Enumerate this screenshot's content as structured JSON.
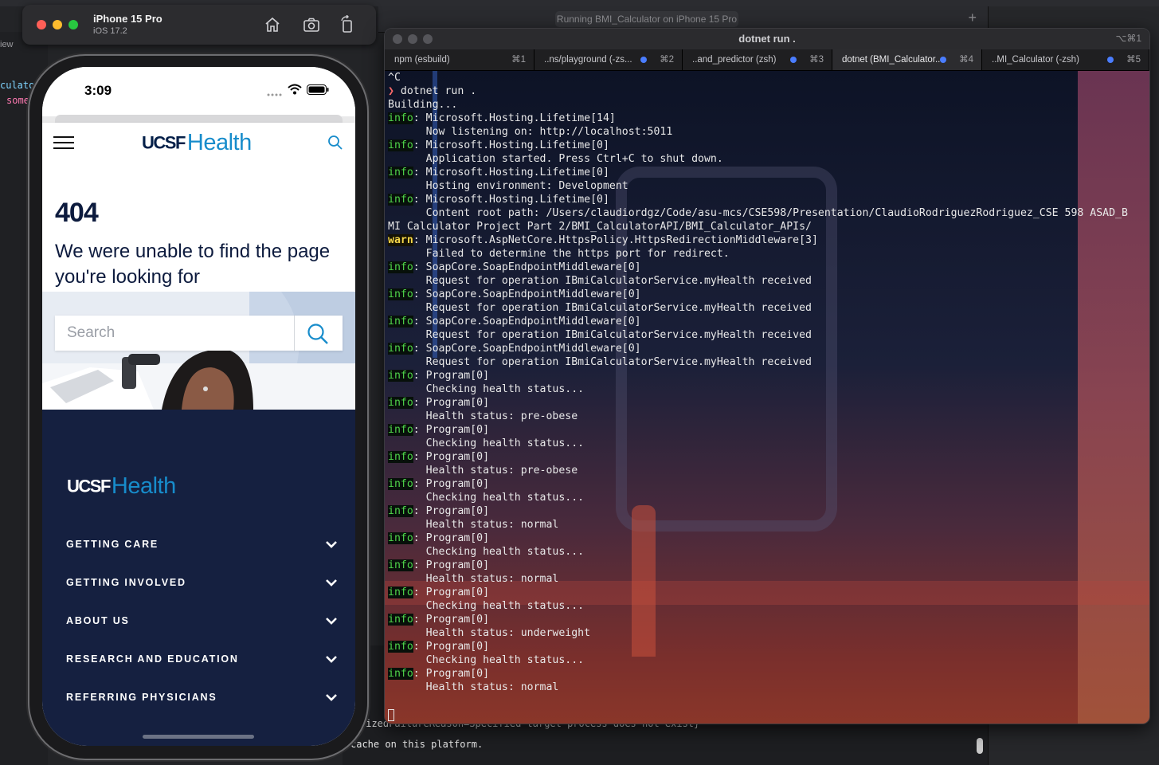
{
  "xcode": {
    "run_status": "Running BMI_Calculator on iPhone 15 Pro",
    "view_label": "iew",
    "code_line_1": "culato",
    "code_line_2": "some",
    "console_line_1": "lizedFailureReason=Specified target process does not exist}",
    "console_line_2": "cache on this platform."
  },
  "simulator": {
    "device_name": "iPhone 15 Pro",
    "os_version": "iOS 17.2",
    "toolbar_icons": [
      "home-icon",
      "screenshot-icon",
      "rotate-icon"
    ]
  },
  "phone": {
    "status_time": "3:09",
    "brand_ucsf": "UCSF",
    "brand_health": "Health",
    "error_code": "404",
    "error_message": "We were unable to find the page you're looking for",
    "search_placeholder": "Search",
    "footer_nav": [
      {
        "label": "GETTING CARE"
      },
      {
        "label": "GETTING INVOLVED"
      },
      {
        "label": "ABOUT US"
      },
      {
        "label": "RESEARCH AND EDUCATION"
      },
      {
        "label": "REFERRING PHYSICIANS"
      }
    ]
  },
  "terminal": {
    "window_title": "dotnet run .",
    "window_shortcut": "⌥⌘1",
    "tabs": [
      {
        "label": "npm (esbuild)",
        "shortcut": "⌘1",
        "active": false
      },
      {
        "label": "..ns/playground (-zs...",
        "shortcut": "⌘2",
        "active": false
      },
      {
        "label": "..and_predictor (zsh)",
        "shortcut": "⌘3",
        "active": false
      },
      {
        "label": "dotnet (BMI_Calculator...",
        "shortcut": "⌘4",
        "active": true
      },
      {
        "label": "..MI_Calculator (-zsh)",
        "shortcut": "⌘5",
        "active": false
      }
    ],
    "colors": {
      "info": "#4fd44a",
      "warn": "#f5d64a",
      "prompt": "#ff6b6b"
    },
    "lines": [
      {
        "text": "^C"
      },
      {
        "prompt": "❯",
        "text": " dotnet run ."
      },
      {
        "text": "Building..."
      },
      {
        "level": "info",
        "text": ": Microsoft.Hosting.Lifetime[14]"
      },
      {
        "text": "      Now listening on: http://localhost:5011"
      },
      {
        "level": "info",
        "text": ": Microsoft.Hosting.Lifetime[0]"
      },
      {
        "text": "      Application started. Press Ctrl+C to shut down."
      },
      {
        "level": "info",
        "text": ": Microsoft.Hosting.Lifetime[0]"
      },
      {
        "text": "      Hosting environment: Development"
      },
      {
        "level": "info",
        "text": ": Microsoft.Hosting.Lifetime[0]"
      },
      {
        "text": "      Content root path: /Users/claudiordgz/Code/asu-mcs/CSE598/Presentation/ClaudioRodriguezRodriguez_CSE 598 ASAD_B"
      },
      {
        "text": "MI Calculator Project Part 2/BMI_CalculatorAPI/BMI_Calculator_APIs/"
      },
      {
        "level": "warn",
        "text": ": Microsoft.AspNetCore.HttpsPolicy.HttpsRedirectionMiddleware[3]"
      },
      {
        "text": "      Failed to determine the https port for redirect."
      },
      {
        "level": "info",
        "text": ": SoapCore.SoapEndpointMiddleware[0]"
      },
      {
        "text": "      Request for operation IBmiCalculatorService.myHealth received"
      },
      {
        "level": "info",
        "text": ": SoapCore.SoapEndpointMiddleware[0]"
      },
      {
        "text": "      Request for operation IBmiCalculatorService.myHealth received"
      },
      {
        "level": "info",
        "text": ": SoapCore.SoapEndpointMiddleware[0]"
      },
      {
        "text": "      Request for operation IBmiCalculatorService.myHealth received"
      },
      {
        "level": "info",
        "text": ": SoapCore.SoapEndpointMiddleware[0]"
      },
      {
        "text": "      Request for operation IBmiCalculatorService.myHealth received"
      },
      {
        "level": "info",
        "text": ": Program[0]"
      },
      {
        "text": "      Checking health status..."
      },
      {
        "level": "info",
        "text": ": Program[0]"
      },
      {
        "text": "      Health status: pre-obese"
      },
      {
        "level": "info",
        "text": ": Program[0]"
      },
      {
        "text": "      Checking health status..."
      },
      {
        "level": "info",
        "text": ": Program[0]"
      },
      {
        "text": "      Health status: pre-obese"
      },
      {
        "level": "info",
        "text": ": Program[0]"
      },
      {
        "text": "      Checking health status..."
      },
      {
        "level": "info",
        "text": ": Program[0]"
      },
      {
        "text": "      Health status: normal"
      },
      {
        "level": "info",
        "text": ": Program[0]"
      },
      {
        "text": "      Checking health status..."
      },
      {
        "level": "info",
        "text": ": Program[0]"
      },
      {
        "text": "      Health status: normal"
      },
      {
        "level": "info",
        "text": ": Program[0]"
      },
      {
        "text": "      Checking health status..."
      },
      {
        "level": "info",
        "text": ": Program[0]"
      },
      {
        "text": "      Health status: underweight"
      },
      {
        "level": "info",
        "text": ": Program[0]"
      },
      {
        "text": "      Checking health status..."
      },
      {
        "level": "info",
        "text": ": Program[0]"
      },
      {
        "text": "      Health status: normal"
      }
    ]
  }
}
